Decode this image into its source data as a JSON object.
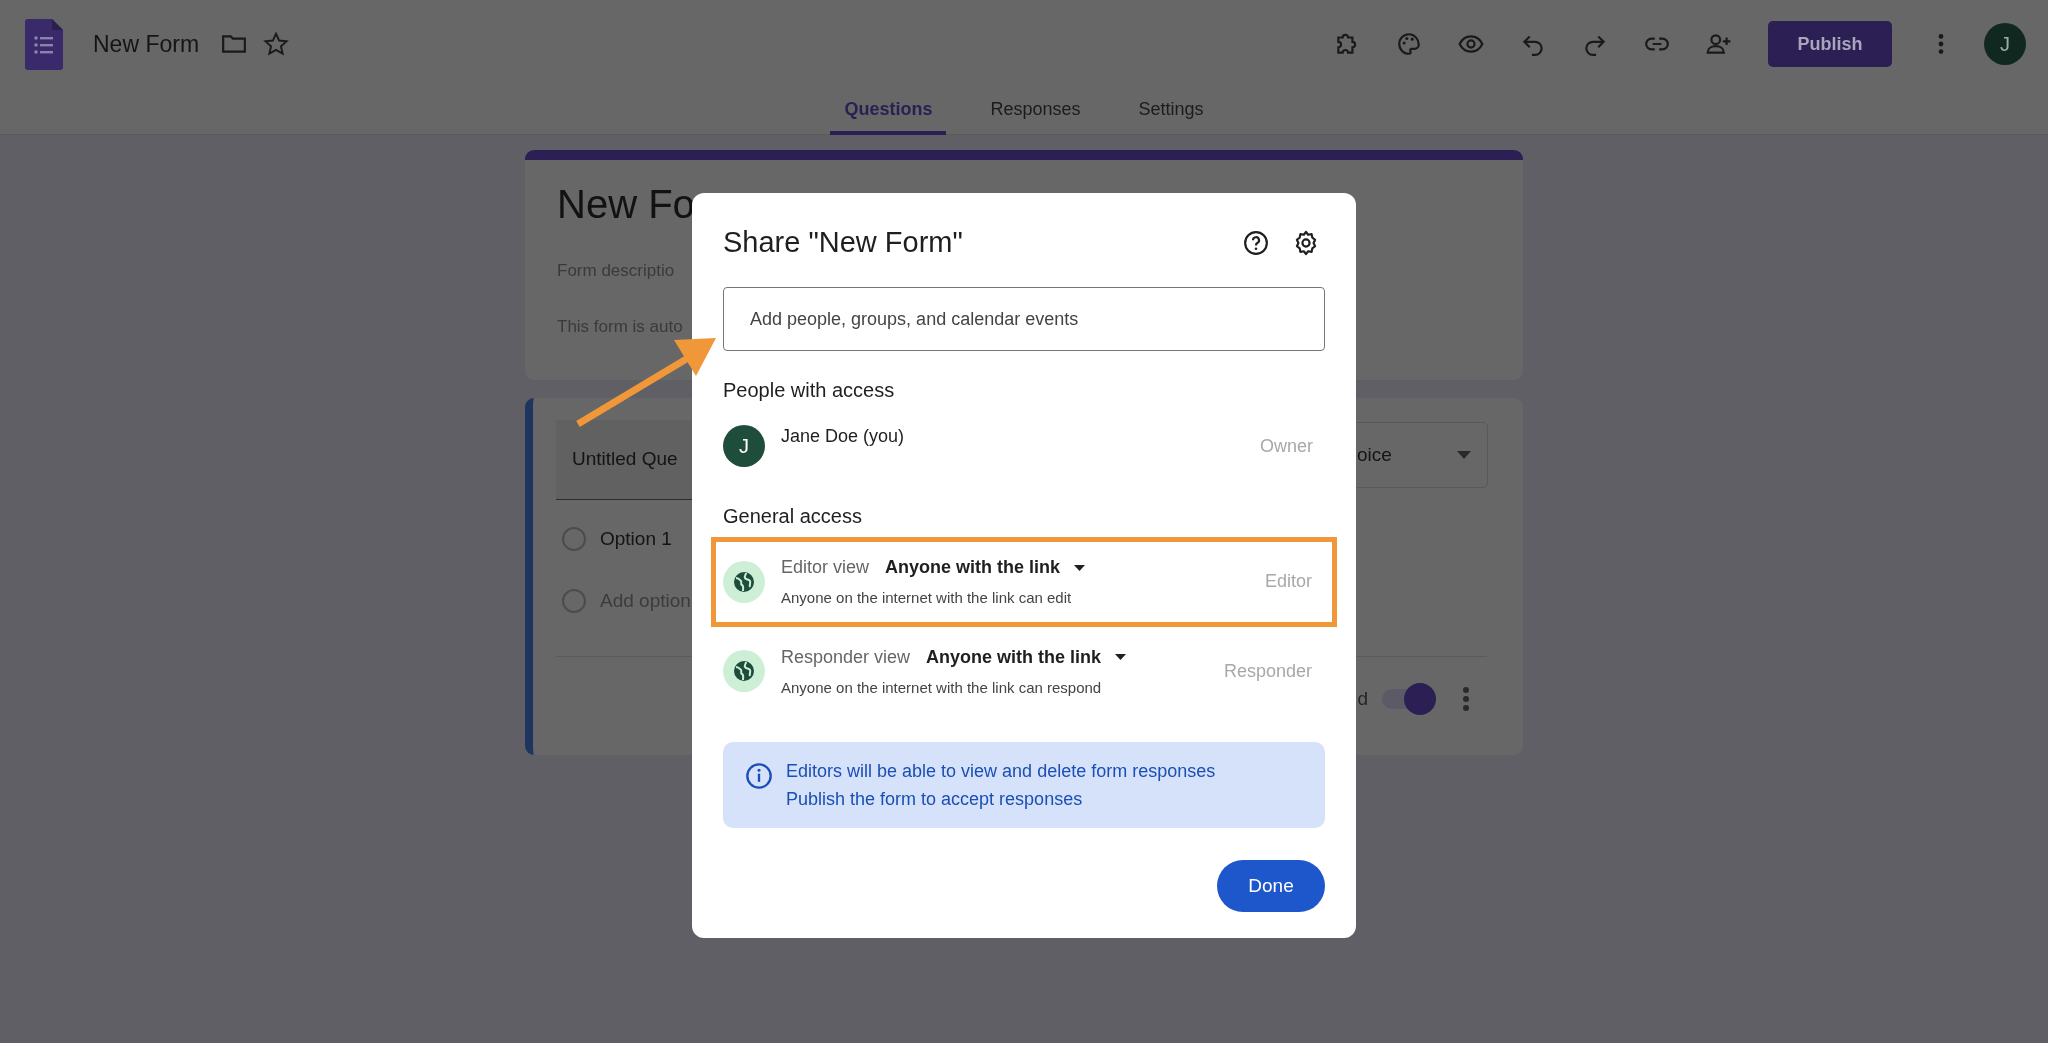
{
  "app": {
    "title": "New Form",
    "publish_button": "Publish",
    "avatar_initial": "J"
  },
  "tabs": [
    {
      "label": "Questions",
      "selected": true
    },
    {
      "label": "Responses",
      "selected": false
    },
    {
      "label": "Settings",
      "selected": false
    }
  ],
  "form_header": {
    "title": "New Fo",
    "description": "Form descriptio",
    "note": "This form is auto"
  },
  "question": {
    "title": "Untitled Que",
    "type": "oice",
    "options": [
      {
        "label": "Option 1",
        "kind": "option",
        "checked": false
      },
      {
        "label": "Add option",
        "kind": "add",
        "checked": false
      }
    ],
    "required_label": "d",
    "required_on": true
  },
  "dialog": {
    "title": "Share \"New Form\"",
    "search": {
      "placeholder": "Add people, groups, and calendar events"
    },
    "people_heading": "People with access",
    "people": [
      {
        "initial": "J",
        "name": "Jane Doe (you)",
        "role": "Owner"
      }
    ],
    "general_heading": "General access",
    "access": [
      {
        "view": "Editor view",
        "audience": "Anyone with the link",
        "description": "Anyone on the internet with the link can edit",
        "role": "Editor",
        "highlighted": true
      },
      {
        "view": "Responder view",
        "audience": "Anyone with the link",
        "description": "Anyone on the internet with the link can respond",
        "role": "Responder",
        "highlighted": false
      }
    ],
    "info": [
      "Editors will be able to view and delete form responses",
      "Publish the form to accept responses"
    ],
    "done_button": "Done"
  }
}
